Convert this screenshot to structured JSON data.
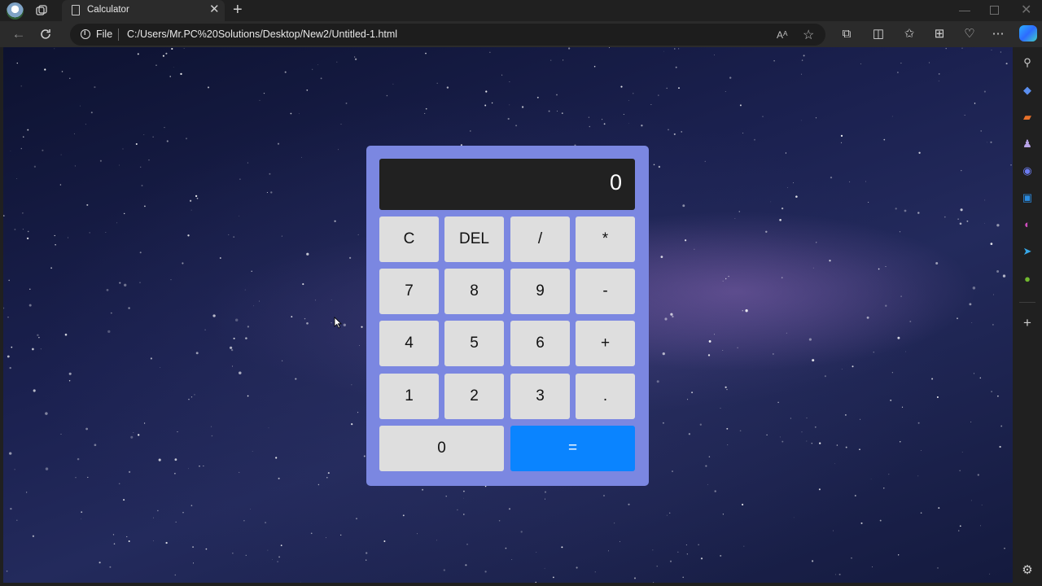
{
  "browser": {
    "tab_title": "Calculator",
    "address_scheme": "File",
    "address_url": "C:/Users/Mr.PC%20Solutions/Desktop/New2/Untitled-1.html"
  },
  "calculator": {
    "display": "0",
    "keys": [
      "C",
      "DEL",
      "/",
      "*",
      "7",
      "8",
      "9",
      "-",
      "4",
      "5",
      "6",
      "+",
      "1",
      "2",
      "3",
      ".",
      "0",
      "="
    ],
    "colors": {
      "panel": "#7b87e1",
      "display_bg": "#212121",
      "key_bg": "#dedede",
      "equals_bg": "#0a84ff"
    }
  }
}
